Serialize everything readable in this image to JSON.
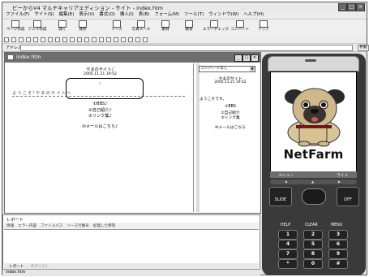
{
  "app": {
    "title": "ビーからV4 マルチキャリアエディション - サイト - index.htm",
    "address_label": "アドレス",
    "go_label": "移動"
  },
  "menu": [
    "ファイル(F)",
    "サイト(S)",
    "編集(E)",
    "表示(V)",
    "書式(O)",
    "挿入(I)",
    "表(B)",
    "フォーム(M)",
    "ツール(T)",
    "ウィンドウ(W)",
    "ヘルプ(H)"
  ],
  "toolbar": [
    "ページ作成",
    "アニメ作成",
    "開く",
    "保存",
    "ソース",
    "写真メール",
    "素材",
    "携帯",
    "エラーチェック",
    "コンバート",
    "アップ"
  ],
  "editor": {
    "tab_title": "index.htm",
    "page_title": "やまのサイト♪",
    "date": "2005.11.21 19:52",
    "welcome": "ようこそ!やまのサイトへ",
    "bbs": "①BBS♪",
    "profile": "②自己紹介♪",
    "links": "③リンク集♪",
    "mail": "✉メールはこちら♪"
  },
  "sidepane": {
    "dropdown": "コンバートなし",
    "title": "やまのサイト",
    "date": "2005.11.21 19:52",
    "welcome": "ようこそです。",
    "bbs": "①BBS",
    "profile": "②自己紹介",
    "links": "③リンク集",
    "mail": "✉メールはこちら"
  },
  "phone": {
    "brand": "NetFarm",
    "soft_left": "メニュー",
    "soft_right": "ライト",
    "slide": "SLIDE",
    "off": "OFF",
    "help": "HELP",
    "clear": "CLEAR",
    "menu": "MENU",
    "keys": [
      "1",
      "2",
      "3",
      "4",
      "5",
      "6",
      "7",
      "8",
      "9",
      "*",
      "0",
      "#"
    ]
  },
  "report": {
    "header": "レポート",
    "tabs": [
      "情報",
      "エラー内容",
      "ファイルパス",
      "ソース行番号",
      "処理した時刻"
    ],
    "bottom_tabs": [
      "レポート",
      "タグリスト"
    ]
  },
  "status": {
    "text": "index.htm"
  }
}
